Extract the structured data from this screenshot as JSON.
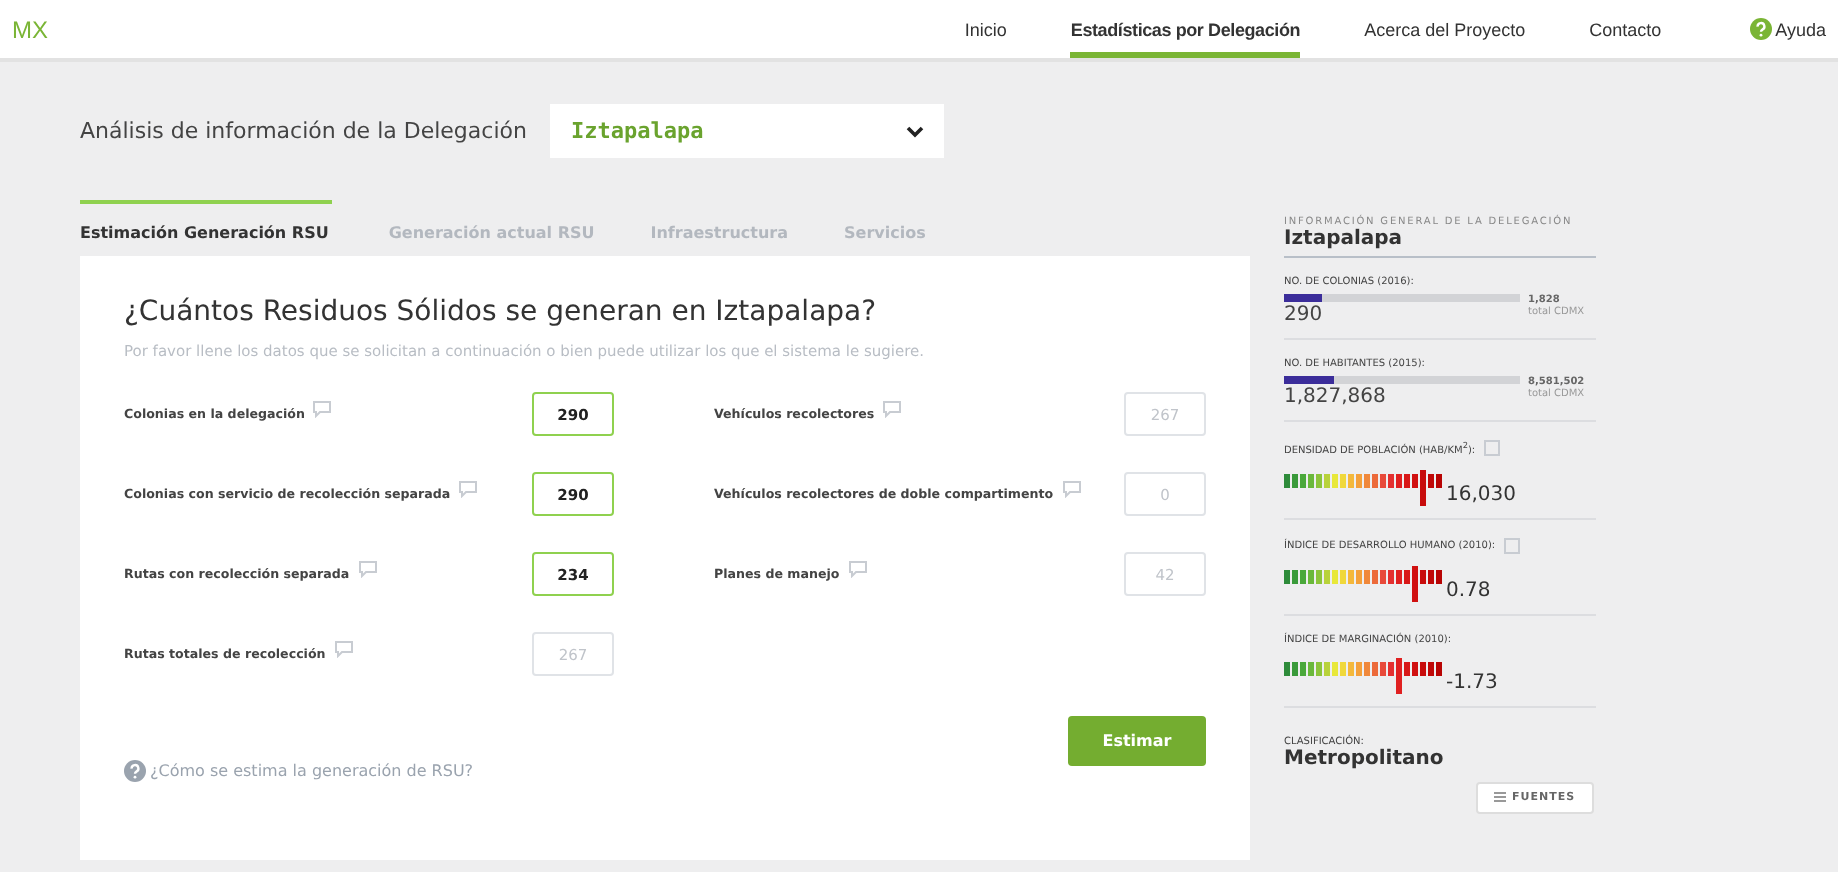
{
  "brand": "MX",
  "nav": [
    {
      "label": "Inicio",
      "selected": false
    },
    {
      "label": "Estadísticas por Delegación",
      "selected": true
    },
    {
      "label": "Acerca del Proyecto",
      "selected": false
    },
    {
      "label": "Contacto",
      "selected": false
    }
  ],
  "help": "Ayuda",
  "header": {
    "label": "Análisis de información de la Delegación",
    "select_value": "Iztapalapa"
  },
  "tabs": [
    {
      "label": "Estimación Generación RSU",
      "selected": true
    },
    {
      "label": "Generación actual RSU",
      "selected": false
    },
    {
      "label": "Infraestructura",
      "selected": false
    },
    {
      "label": "Servicios",
      "selected": false
    }
  ],
  "form": {
    "title": "¿Cuántos Residuos Sólidos se generan en Iztapalapa?",
    "subtitle": "Por favor llene los datos que se solicitan a continuación o bien puede utilizar los que el sistema le sugiere.",
    "left_fields": [
      {
        "label": "Colonias en la delegación",
        "value": "290"
      },
      {
        "label": "Colonias con servicio de recolección separada",
        "value": "290"
      },
      {
        "label": "Rutas con recolección separada",
        "value": "234"
      },
      {
        "label": "Rutas totales de recolección",
        "placeholder": "267"
      }
    ],
    "right_fields": [
      {
        "label": "Vehículos recolectores",
        "placeholder": "267"
      },
      {
        "label": "Vehículos recolectores de doble compartimento",
        "placeholder": "0"
      },
      {
        "label": "Planes de manejo",
        "placeholder": "42"
      }
    ],
    "help_link": "¿Cómo se estima la generación de RSU?",
    "button": "Estimar"
  },
  "sidebar": {
    "heading": "INFORMACIÓN GENERAL DE LA DELEGACIÓN",
    "name": "Iztapalapa",
    "stats": [
      {
        "kind": "bar",
        "label": "NO. DE COLONIAS (2016):",
        "value": "290",
        "level": 0.16,
        "total": "1,828",
        "total_label": "total CDMX"
      },
      {
        "kind": "bar",
        "label": "NO. DE HABITANTES (2015):",
        "value": "1,827,868",
        "level": 0.21,
        "total": "8,581,502",
        "total_label": "total CDMX"
      },
      {
        "kind": "scale",
        "label": "DENSIDAD DE POBLACIÓN (HAB/KM$^{2}$):",
        "value": "16,030",
        "level": 0.9,
        "info": true
      },
      {
        "kind": "scale",
        "label": "ÍNDICE DE DESARROLLO HUMANO (2010):",
        "value": "0.78",
        "level": 0.82,
        "info": true
      },
      {
        "kind": "scale",
        "label": "ÍNDICE DE MARGINACIÓN (2010):",
        "value": "-1.73",
        "level": 0.72,
        "info": false
      }
    ],
    "classification_label": "CLASIFICACIÓN:",
    "classification": "Metropolitano",
    "sources_button": "FUENTES"
  }
}
